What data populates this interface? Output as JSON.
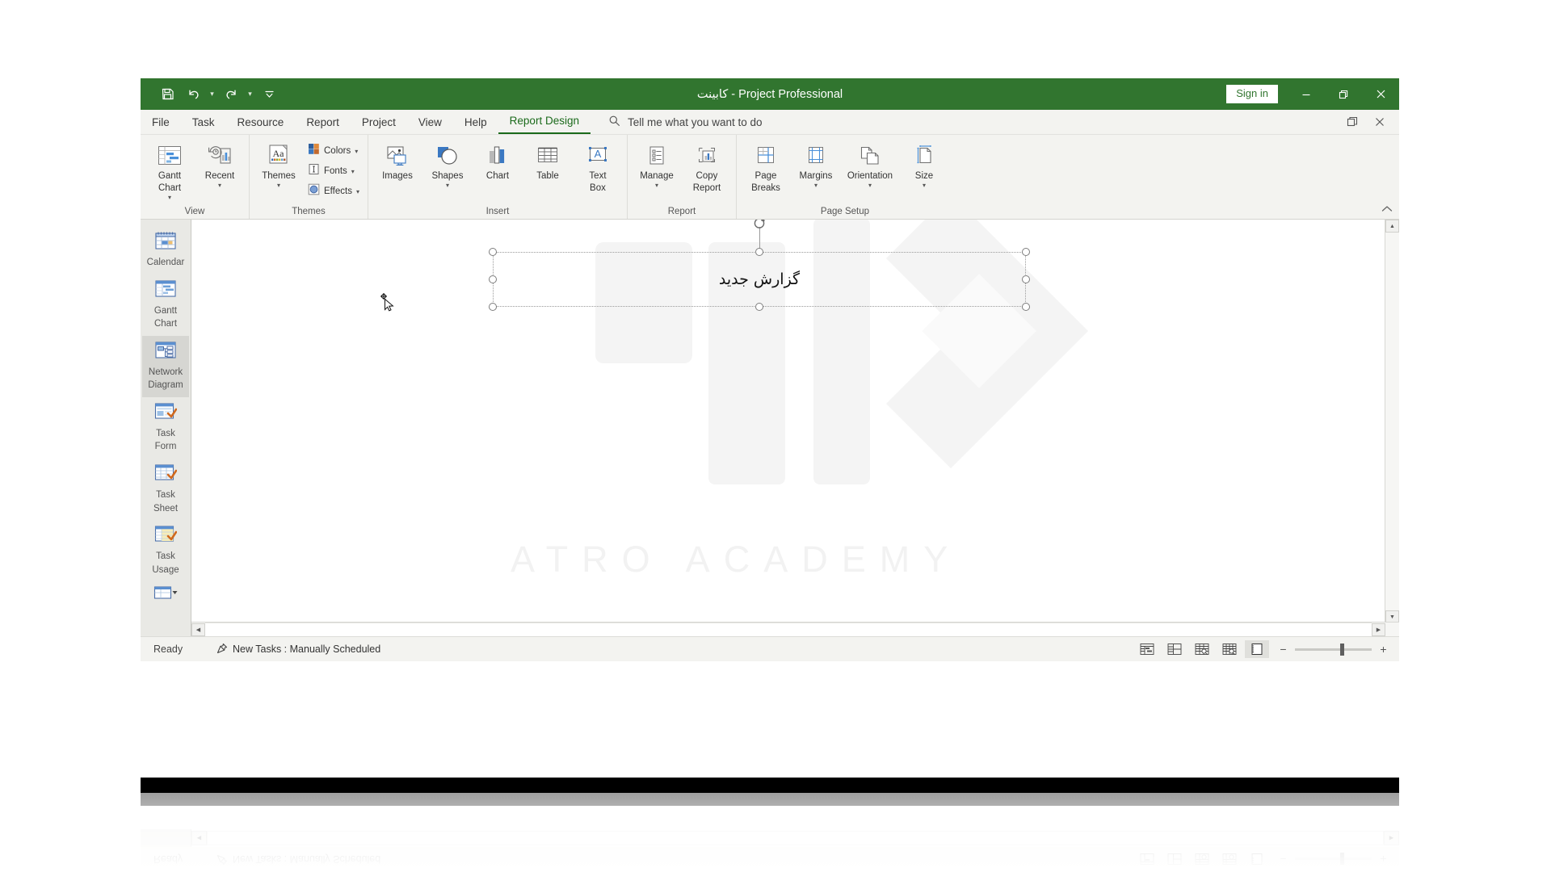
{
  "window": {
    "title_doc": "کابینت",
    "title_sep": "-",
    "title_app": "Project Professional",
    "signin_label": "Sign in",
    "quick_access": [
      {
        "name": "save-icon",
        "label": "Save"
      },
      {
        "name": "undo-icon",
        "label": "Undo"
      },
      {
        "name": "redo-icon",
        "label": "Redo"
      },
      {
        "name": "customize-qat-icon",
        "label": "Customize Quick Access Toolbar"
      }
    ],
    "controls": [
      {
        "name": "minimize-button",
        "label": "Minimize"
      },
      {
        "name": "restore-button",
        "label": "Restore Down"
      },
      {
        "name": "close-button",
        "label": "Close"
      }
    ],
    "accent_color": "#31752f"
  },
  "tabs": [
    {
      "label": "File",
      "active": false
    },
    {
      "label": "Task",
      "active": false
    },
    {
      "label": "Resource",
      "active": false
    },
    {
      "label": "Report",
      "active": false
    },
    {
      "label": "Project",
      "active": false
    },
    {
      "label": "View",
      "active": false
    },
    {
      "label": "Help",
      "active": false
    },
    {
      "label": "Report Design",
      "active": true
    }
  ],
  "tellme": {
    "placeholder": "Tell me what you want to do",
    "icon": "search-icon"
  },
  "tab_right": [
    {
      "name": "ribbon-display-options-button",
      "label": "Ribbon Display Options"
    },
    {
      "name": "close-window-button",
      "label": "Close"
    }
  ],
  "ribbon": {
    "collapse_label": "Collapse the Ribbon",
    "groups": [
      {
        "label": "View",
        "big": [
          {
            "label": "Gantt\nChart",
            "label1": "Gantt",
            "label2": "Chart",
            "icon": "gantt-chart-icon",
            "dropdown": true
          },
          {
            "label": "Recent",
            "label1": "Recent",
            "label2": "",
            "icon": "recent-icon",
            "dropdown": true
          }
        ],
        "small": []
      },
      {
        "label": "Themes",
        "big": [
          {
            "label": "Themes",
            "label1": "Themes",
            "label2": "",
            "icon": "themes-icon",
            "dropdown": true
          }
        ],
        "small": [
          {
            "label": "Colors",
            "icon": "colors-icon",
            "dropdown": true
          },
          {
            "label": "Fonts",
            "icon": "fonts-icon",
            "dropdown": true
          },
          {
            "label": "Effects",
            "icon": "effects-icon",
            "dropdown": true
          }
        ]
      },
      {
        "label": "Insert",
        "big": [
          {
            "label": "Images",
            "label1": "Images",
            "label2": "",
            "icon": "images-icon",
            "dropdown": false
          },
          {
            "label": "Shapes",
            "label1": "Shapes",
            "label2": "",
            "icon": "shapes-icon",
            "dropdown": true
          },
          {
            "label": "Chart",
            "label1": "Chart",
            "label2": "",
            "icon": "chart-icon",
            "dropdown": false
          },
          {
            "label": "Table",
            "label1": "Table",
            "label2": "",
            "icon": "table-icon",
            "dropdown": false
          },
          {
            "label": "Text Box",
            "label1": "Text",
            "label2": "Box",
            "icon": "text-box-icon",
            "dropdown": false
          }
        ],
        "small": []
      },
      {
        "label": "Report",
        "big": [
          {
            "label": "Manage",
            "label1": "Manage",
            "label2": "",
            "icon": "manage-icon",
            "dropdown": true
          },
          {
            "label": "Copy Report",
            "label1": "Copy",
            "label2": "Report",
            "icon": "copy-report-icon",
            "dropdown": false
          }
        ],
        "small": []
      },
      {
        "label": "Page Setup",
        "big": [
          {
            "label": "Page Breaks",
            "label1": "Page",
            "label2": "Breaks",
            "icon": "page-breaks-icon",
            "dropdown": false
          },
          {
            "label": "Margins",
            "label1": "Margins",
            "label2": "",
            "icon": "margins-icon",
            "dropdown": true
          },
          {
            "label": "Orientation",
            "label1": "Orientation",
            "label2": "",
            "icon": "orientation-icon",
            "dropdown": true
          },
          {
            "label": "Size",
            "label1": "Size",
            "label2": "",
            "icon": "size-icon",
            "dropdown": true
          }
        ],
        "small": []
      }
    ]
  },
  "viewbar": {
    "items": [
      {
        "label1": "Calendar",
        "label2": "",
        "icon": "calendar-view-icon",
        "selected": false
      },
      {
        "label1": "Gantt",
        "label2": "Chart",
        "icon": "gantt-chart-view-icon",
        "selected": false
      },
      {
        "label1": "Network",
        "label2": "Diagram",
        "icon": "network-diagram-view-icon",
        "selected": true
      },
      {
        "label1": "Task",
        "label2": "Form",
        "icon": "task-form-view-icon",
        "selected": false
      },
      {
        "label1": "Task",
        "label2": "Sheet",
        "icon": "task-sheet-view-icon",
        "selected": false
      },
      {
        "label1": "Task",
        "label2": "Usage",
        "icon": "task-usage-view-icon",
        "selected": false
      },
      {
        "label1": "",
        "label2": "",
        "icon": "more-views-icon",
        "selected": false
      }
    ]
  },
  "canvas": {
    "textbox_value": "گزارش جدید",
    "watermark_text": "ATRO ACADEMY",
    "watermark_logo": "اترو",
    "cursor": "move-cursor",
    "handles": [
      "top-left",
      "top-center",
      "top-right",
      "middle-left",
      "middle-right",
      "bottom-left",
      "bottom-center",
      "bottom-right"
    ],
    "rotate_handle": "rotate-handle-icon"
  },
  "statusbar": {
    "ready": "Ready",
    "new_tasks": "New Tasks : Manually Scheduled",
    "new_tasks_icon": "pin-icon",
    "view_buttons": [
      {
        "name": "gantt-chart-view-button",
        "label": "Gantt Chart",
        "active": false
      },
      {
        "name": "task-usage-view-button",
        "label": "Task Usage",
        "active": false
      },
      {
        "name": "team-planner-view-button",
        "label": "Team Planner",
        "active": false
      },
      {
        "name": "resource-sheet-view-button",
        "label": "Resource Sheet",
        "active": false
      },
      {
        "name": "report-view-button",
        "label": "Report",
        "active": true
      }
    ],
    "zoom_out": "−",
    "zoom_in": "+"
  }
}
